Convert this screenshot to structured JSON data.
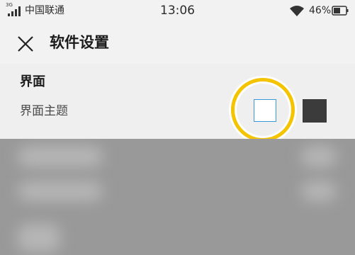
{
  "status_bar": {
    "network_type": "3G",
    "carrier": "中国联通",
    "time": "13:06",
    "battery": "46%"
  },
  "header": {
    "close_icon": "close-icon",
    "title": "软件设置"
  },
  "section": {
    "title": "界面",
    "row_label": "界面主题",
    "options": [
      {
        "name": "light",
        "color": "#ffffff",
        "selected": true
      },
      {
        "name": "dark",
        "color": "#3b3b3b",
        "selected": false
      }
    ],
    "highlight_color": "#f5c400"
  }
}
